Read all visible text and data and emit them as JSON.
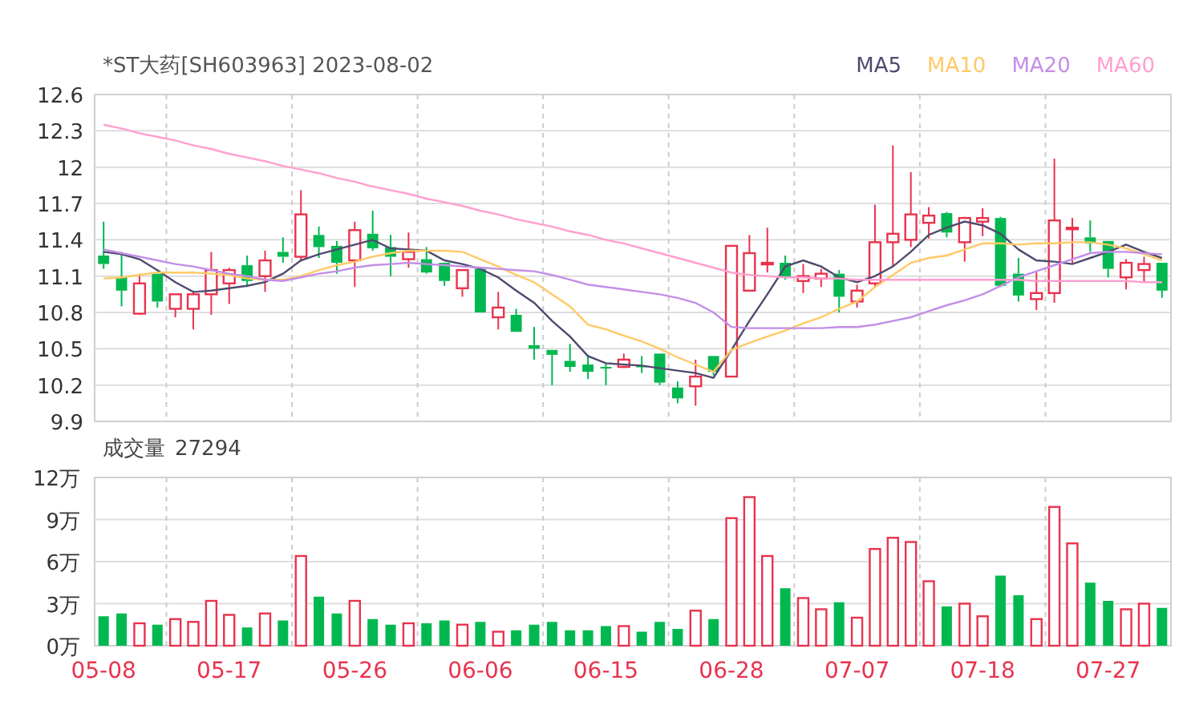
{
  "price_panel": {
    "title": "*ST大药[SH603963] 2023-08-02",
    "chart_data": {
      "type": "candlestick",
      "grid": true,
      "ylim": [
        9.9,
        12.6
      ],
      "yticks": [
        9.9,
        10.2,
        10.5,
        10.8,
        11.1,
        11.4,
        11.7,
        12,
        12.3,
        12.6
      ],
      "series": [
        {
          "name": "MA5",
          "type": "line",
          "color": "#4f4a6e",
          "values": [
            11.3,
            11.28,
            11.24,
            11.15,
            11.05,
            10.97,
            10.98,
            11.0,
            11.02,
            11.05,
            11.12,
            11.23,
            11.28,
            11.32,
            11.36,
            11.4,
            11.33,
            11.32,
            11.31,
            11.23,
            11.2,
            11.16,
            11.09,
            10.98,
            10.88,
            10.73,
            10.6,
            10.44,
            10.38,
            10.37,
            10.36,
            10.34,
            10.32,
            10.3,
            10.26,
            10.49,
            10.73,
            10.95,
            11.18,
            11.23,
            11.18,
            11.09,
            11.05,
            11.1,
            11.18,
            11.3,
            11.44,
            11.5,
            11.55,
            11.52,
            11.45,
            11.32,
            11.23,
            11.22,
            11.2,
            11.25,
            11.3,
            11.36,
            11.3,
            11.25
          ]
        },
        {
          "name": "MA10",
          "type": "line",
          "color": "#ffc966",
          "values": [
            11.08,
            11.09,
            11.11,
            11.13,
            11.13,
            11.13,
            11.12,
            11.11,
            11.08,
            11.07,
            11.07,
            11.1,
            11.15,
            11.19,
            11.22,
            11.26,
            11.29,
            11.31,
            11.31,
            11.31,
            11.3,
            11.24,
            11.18,
            11.11,
            11.05,
            10.95,
            10.85,
            10.7,
            10.66,
            10.61,
            10.56,
            10.5,
            10.43,
            10.37,
            10.31,
            10.49,
            10.55,
            10.6,
            10.65,
            10.71,
            10.76,
            10.83,
            10.89,
            11.01,
            11.11,
            11.21,
            11.25,
            11.27,
            11.32,
            11.37,
            11.37,
            11.36,
            11.37,
            11.37,
            11.38,
            11.38,
            11.36,
            11.33,
            11.28,
            11.23
          ]
        },
        {
          "name": "MA20",
          "type": "line",
          "color": "#c38ee6",
          "values": [
            11.32,
            11.29,
            11.26,
            11.23,
            11.2,
            11.18,
            11.15,
            11.12,
            11.1,
            11.07,
            11.06,
            11.09,
            11.12,
            11.14,
            11.17,
            11.19,
            11.2,
            11.21,
            11.2,
            11.19,
            11.18,
            11.17,
            11.16,
            11.15,
            11.14,
            11.11,
            11.07,
            11.03,
            11.01,
            10.99,
            10.97,
            10.95,
            10.92,
            10.88,
            10.8,
            10.68,
            10.67,
            10.67,
            10.67,
            10.67,
            10.67,
            10.68,
            10.68,
            10.7,
            10.73,
            10.76,
            10.81,
            10.86,
            10.9,
            10.95,
            11.02,
            11.09,
            11.14,
            11.19,
            11.24,
            11.29,
            11.3,
            11.3,
            11.29,
            11.28
          ]
        },
        {
          "name": "MA60",
          "type": "line",
          "color": "#ff9fcf",
          "values": [
            12.35,
            12.32,
            12.28,
            12.25,
            12.22,
            12.18,
            12.15,
            12.11,
            12.08,
            12.05,
            12.01,
            11.98,
            11.95,
            11.91,
            11.88,
            11.84,
            11.81,
            11.78,
            11.74,
            11.71,
            11.68,
            11.64,
            11.61,
            11.57,
            11.54,
            11.51,
            11.47,
            11.44,
            11.4,
            11.37,
            11.33,
            11.29,
            11.25,
            11.21,
            11.17,
            11.13,
            11.11,
            11.1,
            11.09,
            11.09,
            11.08,
            11.08,
            11.07,
            11.07,
            11.07,
            11.07,
            11.07,
            11.07,
            11.07,
            11.07,
            11.07,
            11.07,
            11.06,
            11.06,
            11.06,
            11.06,
            11.06,
            11.06,
            11.05,
            11.05
          ]
        }
      ],
      "ohlc": [
        [
          11.27,
          11.55,
          11.16,
          11.2
        ],
        [
          11.09,
          11.3,
          10.85,
          10.98
        ],
        [
          10.79,
          11.12,
          10.78,
          11.04
        ],
        [
          11.12,
          11.12,
          10.84,
          10.89
        ],
        [
          10.83,
          10.95,
          10.76,
          10.95
        ],
        [
          10.83,
          10.97,
          10.66,
          10.95
        ],
        [
          10.95,
          11.3,
          10.78,
          11.15
        ],
        [
          11.04,
          11.17,
          10.87,
          11.15
        ],
        [
          11.19,
          11.27,
          11.01,
          11.06
        ],
        [
          11.1,
          11.31,
          10.97,
          11.23
        ],
        [
          11.3,
          11.42,
          11.21,
          11.26
        ],
        [
          11.26,
          11.81,
          11.22,
          11.61
        ],
        [
          11.44,
          11.51,
          11.25,
          11.34
        ],
        [
          11.35,
          11.39,
          11.12,
          11.21
        ],
        [
          11.23,
          11.55,
          11.01,
          11.48
        ],
        [
          11.45,
          11.64,
          11.31,
          11.33
        ],
        [
          11.34,
          11.44,
          11.1,
          11.26
        ],
        [
          11.24,
          11.46,
          11.17,
          11.3
        ],
        [
          11.24,
          11.34,
          11.12,
          11.13
        ],
        [
          11.21,
          11.21,
          11.02,
          11.06
        ],
        [
          11.0,
          11.15,
          10.93,
          11.15
        ],
        [
          11.16,
          11.16,
          10.8,
          10.8
        ],
        [
          10.76,
          10.97,
          10.66,
          10.84
        ],
        [
          10.78,
          10.83,
          10.64,
          10.64
        ],
        [
          10.53,
          10.68,
          10.41,
          10.5
        ],
        [
          10.49,
          10.49,
          10.2,
          10.45
        ],
        [
          10.4,
          10.54,
          10.31,
          10.35
        ],
        [
          10.37,
          10.45,
          10.25,
          10.31
        ],
        [
          10.35,
          10.38,
          10.2,
          10.34
        ],
        [
          10.35,
          10.46,
          10.34,
          10.41
        ],
        [
          10.36,
          10.44,
          10.3,
          10.35
        ],
        [
          10.46,
          10.46,
          10.2,
          10.22
        ],
        [
          10.18,
          10.23,
          10.05,
          10.09
        ],
        [
          10.19,
          10.41,
          10.03,
          10.27
        ],
        [
          10.44,
          10.44,
          10.28,
          10.31
        ],
        [
          10.27,
          11.35,
          10.27,
          11.35
        ],
        [
          10.98,
          11.44,
          10.98,
          11.29
        ],
        [
          11.2,
          11.5,
          11.13,
          11.21
        ],
        [
          11.21,
          11.27,
          11.07,
          11.09
        ],
        [
          11.06,
          11.2,
          10.96,
          11.1
        ],
        [
          11.08,
          11.16,
          11.01,
          11.12
        ],
        [
          11.12,
          11.15,
          10.8,
          10.93
        ],
        [
          10.89,
          11.03,
          10.84,
          10.98
        ],
        [
          11.04,
          11.69,
          11.01,
          11.38
        ],
        [
          11.38,
          12.18,
          11.18,
          11.45
        ],
        [
          11.4,
          11.96,
          11.34,
          11.61
        ],
        [
          11.54,
          11.67,
          11.41,
          11.6
        ],
        [
          11.62,
          11.63,
          11.42,
          11.46
        ],
        [
          11.38,
          11.59,
          11.22,
          11.58
        ],
        [
          11.55,
          11.66,
          11.43,
          11.58
        ],
        [
          11.58,
          11.59,
          11.01,
          11.02
        ],
        [
          11.12,
          11.25,
          10.89,
          10.94
        ],
        [
          10.91,
          11.13,
          10.82,
          10.96
        ],
        [
          10.96,
          12.07,
          10.88,
          11.56
        ],
        [
          11.49,
          11.58,
          11.21,
          11.5
        ],
        [
          11.42,
          11.56,
          11.3,
          11.37
        ],
        [
          11.39,
          11.39,
          11.09,
          11.16
        ],
        [
          11.09,
          11.24,
          10.99,
          11.21
        ],
        [
          11.15,
          11.26,
          11.05,
          11.2
        ],
        [
          11.21,
          11.21,
          10.92,
          10.98
        ]
      ]
    }
  },
  "volume_panel": {
    "title": "成交量",
    "reading": "27294",
    "chart_data": {
      "type": "bar",
      "grid": true,
      "ylim": [
        0,
        12
      ],
      "categories": [
        "05-08",
        null,
        null,
        null,
        null,
        null,
        null,
        "05-17",
        null,
        null,
        null,
        null,
        null,
        null,
        "05-26",
        null,
        null,
        null,
        null,
        null,
        null,
        "06-06",
        null,
        null,
        null,
        null,
        null,
        null,
        "06-15",
        null,
        null,
        null,
        null,
        null,
        null,
        "06-28",
        null,
        null,
        null,
        null,
        null,
        null,
        "07-07",
        null,
        null,
        null,
        null,
        null,
        null,
        "07-18",
        null,
        null,
        null,
        null,
        null,
        null,
        "07-27",
        null,
        null,
        null
      ],
      "yticks": [
        {
          "value": 0,
          "label": "0万"
        },
        {
          "value": 3,
          "label": "3万"
        },
        {
          "value": 6,
          "label": "6万"
        },
        {
          "value": 9,
          "label": "9万"
        },
        {
          "value": 12,
          "label": "12万"
        }
      ],
      "values": [
        2.1,
        2.3,
        1.6,
        1.5,
        1.9,
        1.7,
        3.2,
        2.2,
        1.3,
        2.3,
        1.8,
        6.4,
        3.5,
        2.3,
        3.2,
        1.9,
        1.5,
        1.6,
        1.6,
        1.8,
        1.5,
        1.7,
        1.0,
        1.1,
        1.5,
        1.7,
        1.1,
        1.1,
        1.4,
        1.4,
        1.0,
        1.7,
        1.2,
        2.5,
        1.9,
        9.1,
        10.6,
        6.4,
        4.1,
        3.4,
        2.6,
        3.1,
        2.0,
        6.9,
        7.7,
        7.4,
        4.6,
        2.8,
        3.0,
        2.1,
        5.0,
        3.6,
        1.9,
        9.9,
        7.3,
        4.5,
        3.2,
        2.6,
        3.0,
        2.7
      ]
    }
  }
}
